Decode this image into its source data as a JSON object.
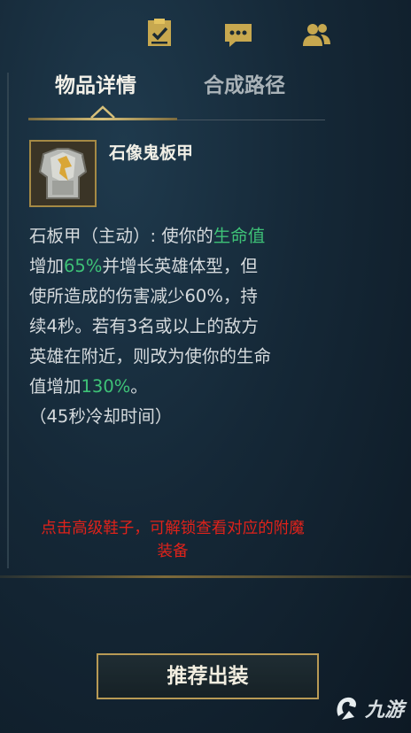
{
  "tabs": {
    "details_label": "物品详情",
    "build_path_label": "合成路径"
  },
  "item": {
    "name": "石像鬼板甲"
  },
  "description": {
    "line1_prefix": "石板甲（主动）: 使你的",
    "line1_highlight": "生命值",
    "line2_prefix": "增加",
    "line2_highlight": "65%",
    "line2_suffix": "并增长英雄体型，但",
    "line3": "使所造成的伤害减少60%，持",
    "line4": "续4秒。若有3名或以上的敌方",
    "line5": "英雄在附近，则改为使你的生命",
    "line6_prefix": "值增加",
    "line6_highlight": "130%",
    "line6_suffix": "。",
    "cooldown": "（45秒冷却时间）"
  },
  "notice": {
    "line1": "点击高级鞋子，可解锁查看对应的附魔",
    "line2": "装备"
  },
  "buttons": {
    "recommend_label": "推荐出装"
  },
  "watermark": {
    "text": "九游"
  },
  "colors": {
    "highlight": "#3ec277",
    "notice": "#e0221a",
    "gold_border": "#b89a55"
  }
}
